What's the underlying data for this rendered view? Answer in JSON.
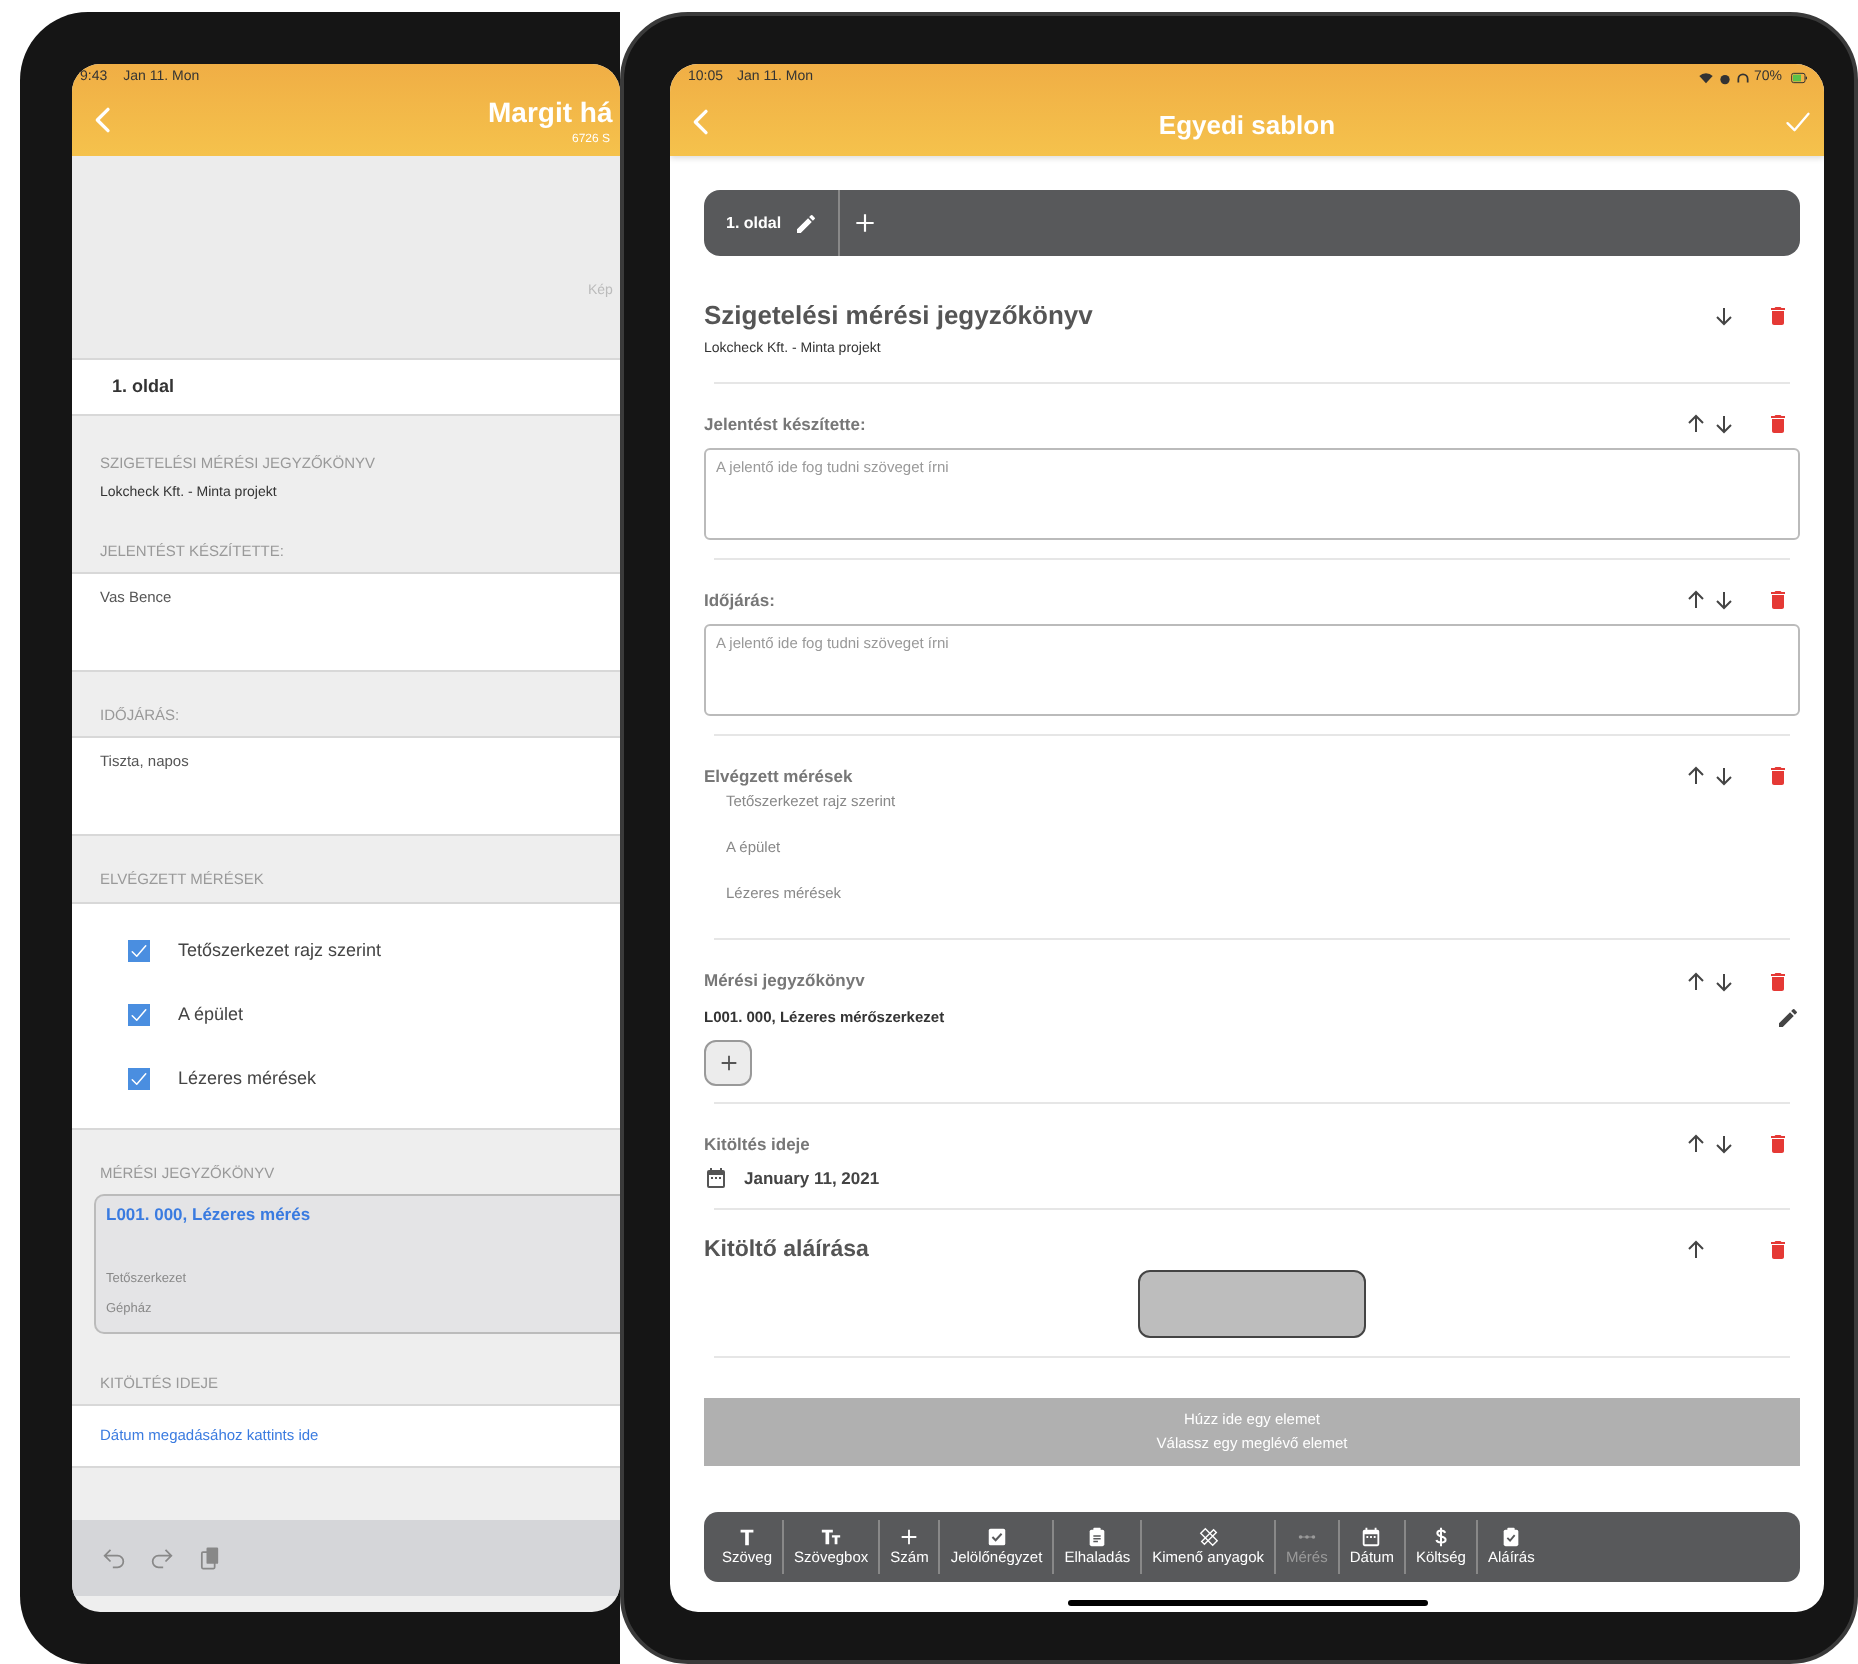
{
  "back_screen": {
    "status_time": "9:43",
    "status_date": "Jan 11. Mon",
    "title": "Margit há",
    "subtitle": "6726 S",
    "image_caption": "Kép",
    "page_tab": "1. oldal",
    "sections": [
      {
        "kind": "heading",
        "label": "SZIGETELÉSI MÉRÉSI JEGYZŐKÖNYV",
        "value": "Lokcheck Kft. - Minta projekt"
      },
      {
        "kind": "text",
        "label": "JELENTÉST KÉSZÍTETTE:",
        "value": "Vas Bence"
      },
      {
        "kind": "text",
        "label": "IDŐJÁRÁS:",
        "value": "Tiszta, napos"
      },
      {
        "kind": "checklist",
        "label": "ELVÉGZETT MÉRÉSEK",
        "items": [
          {
            "label": "Tetőszerkezet rajz szerint",
            "checked": true
          },
          {
            "label": "A épület",
            "checked": true
          },
          {
            "label": "Lézeres mérések",
            "checked": true
          }
        ]
      },
      {
        "kind": "measurement",
        "label": "MÉRÉSI JEGYZŐKÖNYV",
        "title": "L001. 000, Lézeres mérés",
        "lines": [
          "Tetőszerkezet",
          "Gépház"
        ]
      },
      {
        "kind": "date",
        "label": "KITÖLTÉS IDEJE",
        "value": "Dátum megadásához kattints ide"
      }
    ]
  },
  "front_screen": {
    "status_time": "10:05",
    "status_date": "Jan 11. Mon",
    "battery": "70%",
    "title": "Egyedi sablon",
    "page_tab": "1. oldal",
    "elements": [
      {
        "kind": "heading",
        "title": "Szigetelési mérési jegyzőkönyv",
        "subtitle": "Lokcheck Kft. - Minta projekt",
        "can_move_up": false,
        "can_move_down": true
      },
      {
        "kind": "textbox",
        "label": "Jelentést készítette:",
        "placeholder": "A jelentő ide fog tudni szöveget írni",
        "can_move_up": true,
        "can_move_down": true
      },
      {
        "kind": "textbox",
        "label": "Időjárás:",
        "placeholder": "A jelentő ide fog tudni szöveget írni",
        "can_move_up": true,
        "can_move_down": true
      },
      {
        "kind": "checklist",
        "label": "Elvégzett mérések",
        "items": [
          "Tetőszerkezet rajz szerint",
          "A épület",
          "Lézeres mérések"
        ],
        "can_move_up": true,
        "can_move_down": true
      },
      {
        "kind": "measurement",
        "label": "Mérési jegyzőkönyv",
        "entry": "L001. 000, Lézeres mérőszerkezet",
        "can_move_up": true,
        "can_move_down": true
      },
      {
        "kind": "date",
        "label": "Kitöltés ideje",
        "value": "January 11, 2021",
        "can_move_up": true,
        "can_move_down": true
      },
      {
        "kind": "signature",
        "label": "Kitöltő aláírása",
        "can_move_up": true,
        "can_move_down": false
      }
    ],
    "drop_zone": [
      "Húzz ide egy elemet",
      "Válassz egy meglévő elemet"
    ],
    "toolbar": [
      {
        "kind": "text",
        "label": "Szöveg",
        "disabled": false
      },
      {
        "kind": "textbox",
        "label": "Szövegbox",
        "disabled": false
      },
      {
        "kind": "number",
        "label": "Szám",
        "disabled": false
      },
      {
        "kind": "checkbox",
        "label": "Jelölőnégyzet",
        "disabled": false
      },
      {
        "kind": "progress",
        "label": "Elhaladás",
        "disabled": false
      },
      {
        "kind": "materials",
        "label": "Kimenő anyagok",
        "disabled": false
      },
      {
        "kind": "measure",
        "label": "Mérés",
        "disabled": true
      },
      {
        "kind": "date",
        "label": "Dátum",
        "disabled": false
      },
      {
        "kind": "cost",
        "label": "Költség",
        "disabled": false
      },
      {
        "kind": "signature",
        "label": "Aláírás",
        "disabled": false
      }
    ]
  }
}
